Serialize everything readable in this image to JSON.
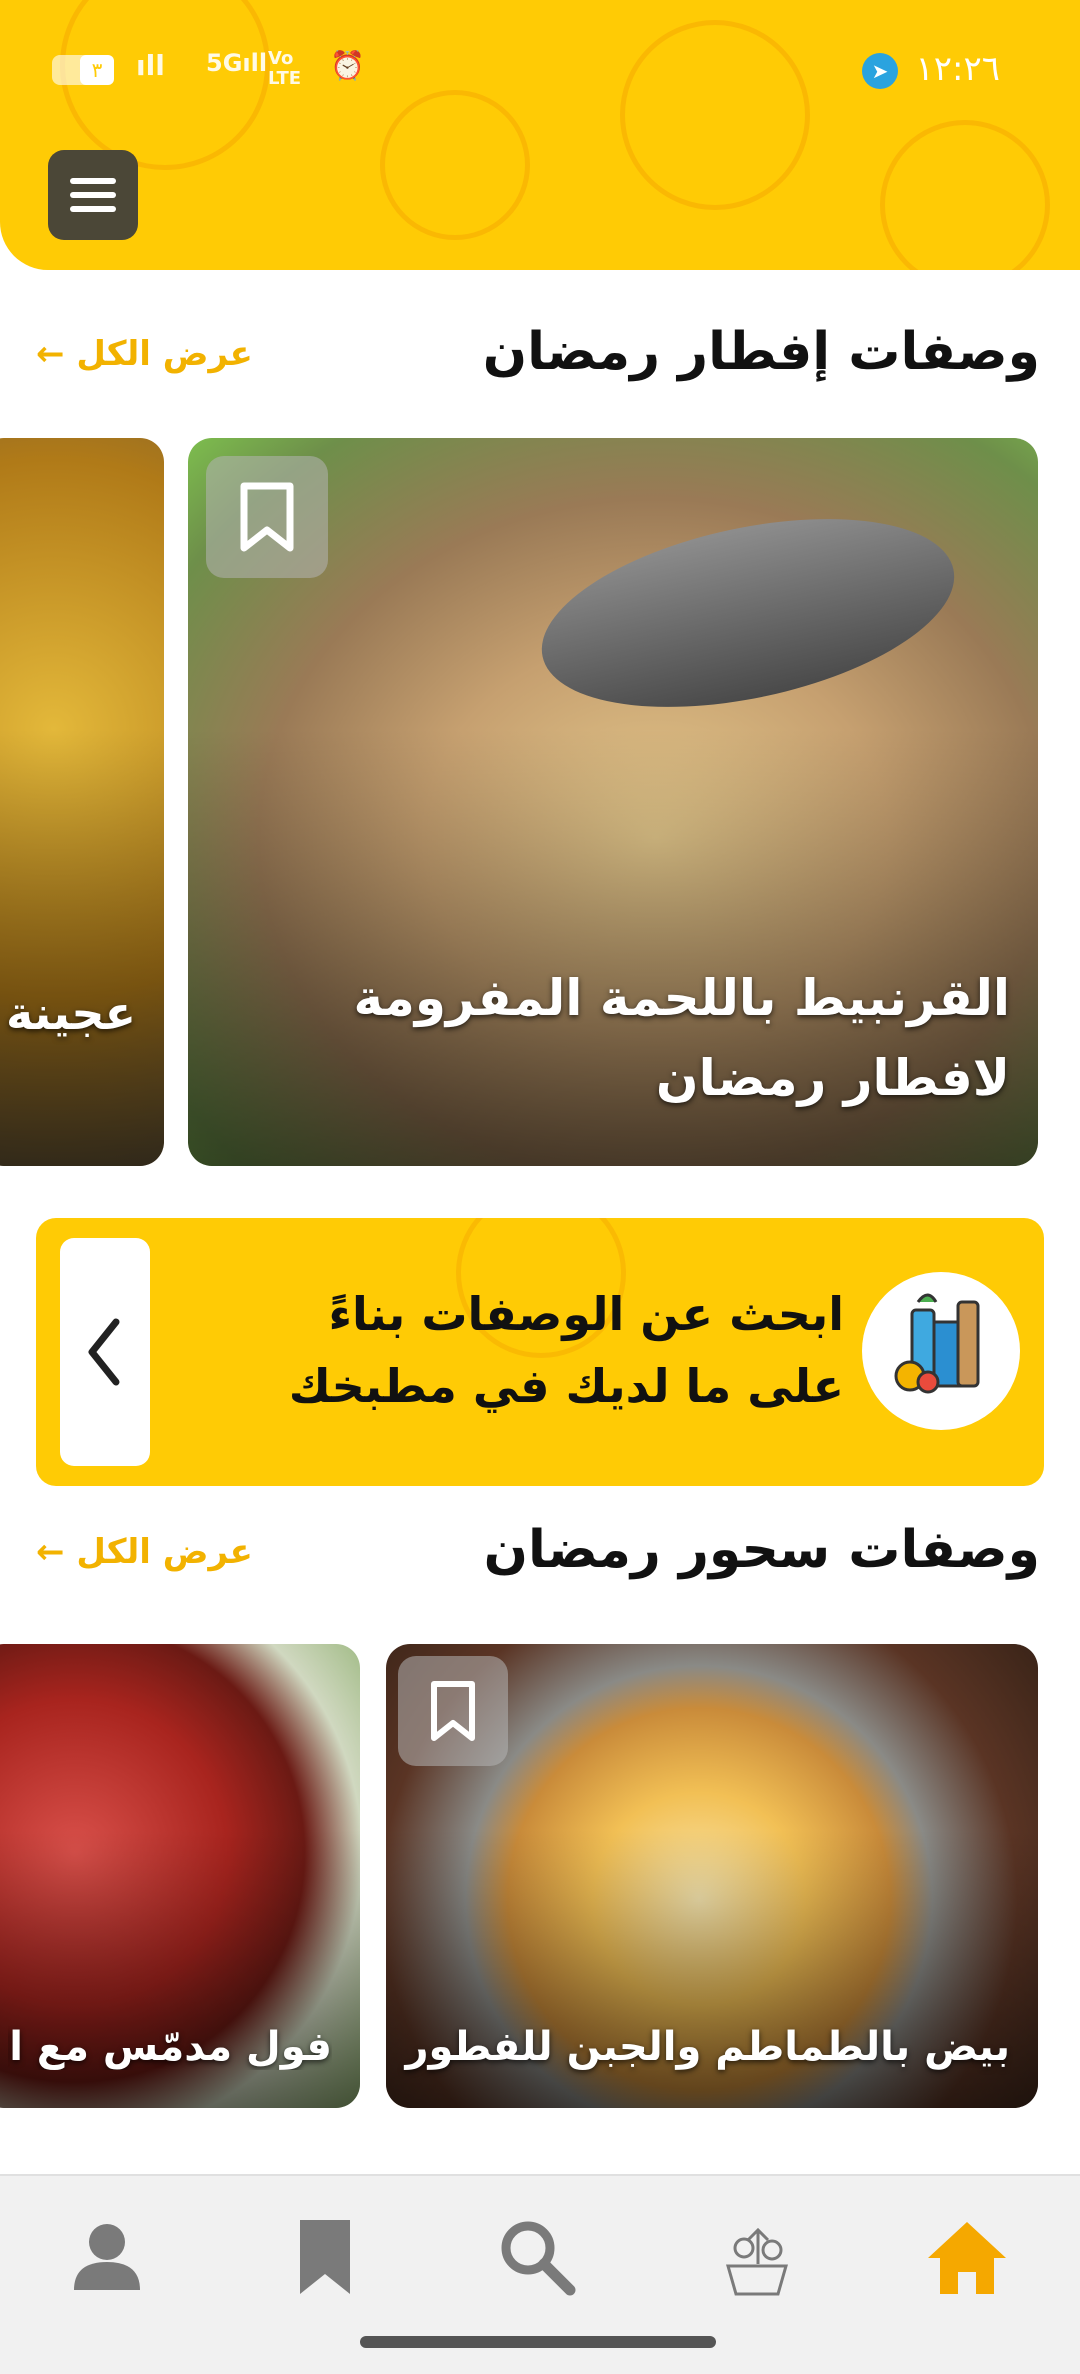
{
  "status_bar": {
    "time": "١٢:٢٦",
    "battery": "٣"
  },
  "header": {
    "menu_label": "menu"
  },
  "iftar_section": {
    "title": "وصفات إفطار رمضان",
    "see_all": "عرض الكل",
    "cards": [
      {
        "title": "القرنبيط باللحمة المفرومة لافطار رمضان"
      },
      {
        "title": "عجينة رمضان"
      }
    ]
  },
  "search_banner": {
    "text": "ابحث عن الوصفات بناءً على ما لديك في مطبخك"
  },
  "suhoor_section": {
    "title": "وصفات سحور رمضان",
    "see_all": "عرض الكل",
    "cards": [
      {
        "title": "بيض بالطماطم والجبن للفطور"
      },
      {
        "title": "فول مدمّس مع الص"
      }
    ]
  },
  "bottom_nav": [
    "profile-icon",
    "bookmark-icon",
    "search-icon",
    "ingredients-icon",
    "home-icon"
  ],
  "colors": {
    "accent": "#FFCB05",
    "accent_text": "#F2B200",
    "active_nav": "#F5A800"
  }
}
